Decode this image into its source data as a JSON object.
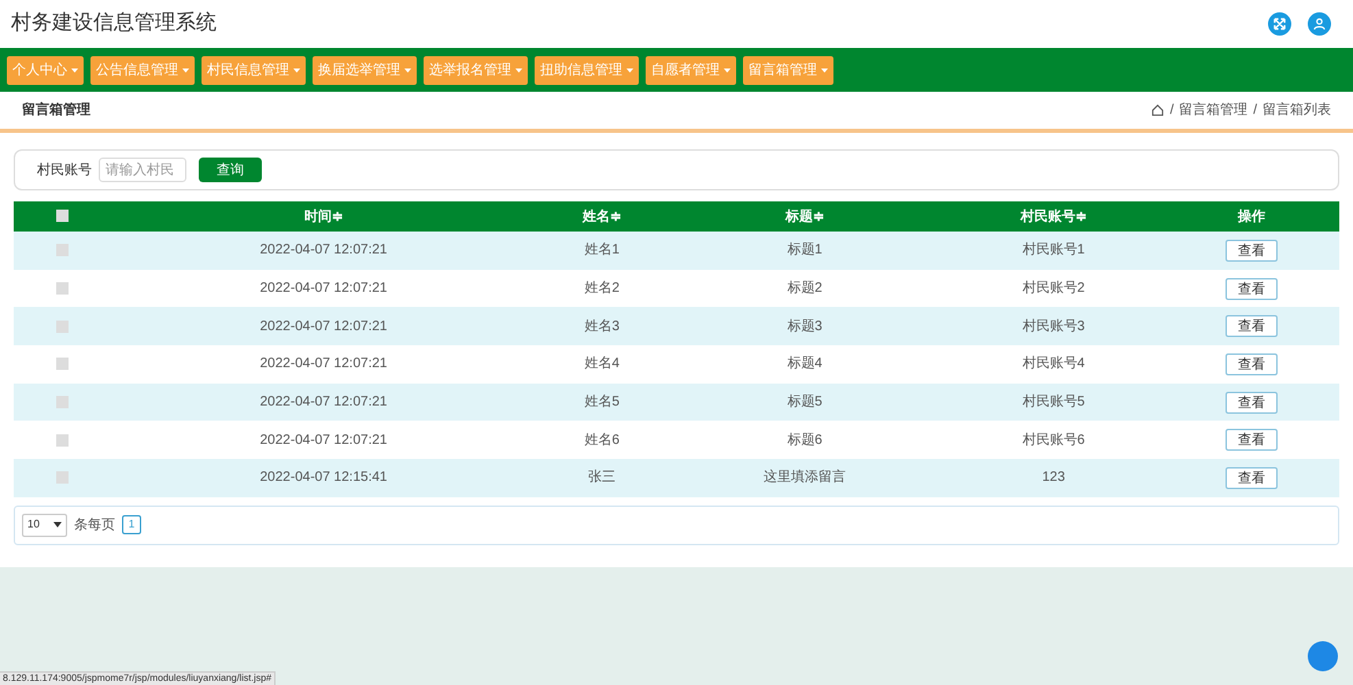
{
  "header": {
    "title": "村务建设信息管理系统"
  },
  "nav": [
    {
      "label": "个人中心"
    },
    {
      "label": "公告信息管理"
    },
    {
      "label": "村民信息管理"
    },
    {
      "label": "换届选举管理"
    },
    {
      "label": "选举报名管理"
    },
    {
      "label": "扭助信息管理"
    },
    {
      "label": "自愿者管理"
    },
    {
      "label": "留言箱管理"
    }
  ],
  "page_title": "留言箱管理",
  "breadcrumb": [
    "留言箱管理",
    "留言箱列表"
  ],
  "breadcrumb_separator": "/",
  "search": {
    "label": "村民账号",
    "placeholder": "请输入村民",
    "button": "查询"
  },
  "table": {
    "columns": [
      "时间",
      "姓名",
      "标题",
      "村民账号",
      "操作"
    ],
    "sort_mark": "≑",
    "all_checked": false,
    "rows": [
      {
        "checked": false,
        "cells": [
          "2022-04-07 12:07:21",
          "姓名1",
          "标题1",
          "村民账号1"
        ],
        "action": "查看"
      },
      {
        "checked": false,
        "cells": [
          "2022-04-07 12:07:21",
          "姓名2",
          "标题2",
          "村民账号2"
        ],
        "action": "查看"
      },
      {
        "checked": false,
        "cells": [
          "2022-04-07 12:07:21",
          "姓名3",
          "标题3",
          "村民账号3"
        ],
        "action": "查看"
      },
      {
        "checked": false,
        "cells": [
          "2022-04-07 12:07:21",
          "姓名4",
          "标题4",
          "村民账号4"
        ],
        "action": "查看"
      },
      {
        "checked": false,
        "cells": [
          "2022-04-07 12:07:21",
          "姓名5",
          "标题5",
          "村民账号5"
        ],
        "action": "查看"
      },
      {
        "checked": false,
        "cells": [
          "2022-04-07 12:07:21",
          "姓名6",
          "标题6",
          "村民账号6"
        ],
        "action": "查看"
      },
      {
        "checked": false,
        "cells": [
          "2022-04-07 12:15:41",
          "张三",
          "这里填添留言",
          "123"
        ],
        "action": "查看"
      }
    ]
  },
  "pagination": {
    "page_size": "10",
    "per_page_label": "条每页",
    "pages": [
      {
        "label": "1",
        "selected": true
      }
    ]
  },
  "status_url": "8.129.11.174:9005/jspmome7r/jsp/modules/liuyanxiang/list.jsp#"
}
